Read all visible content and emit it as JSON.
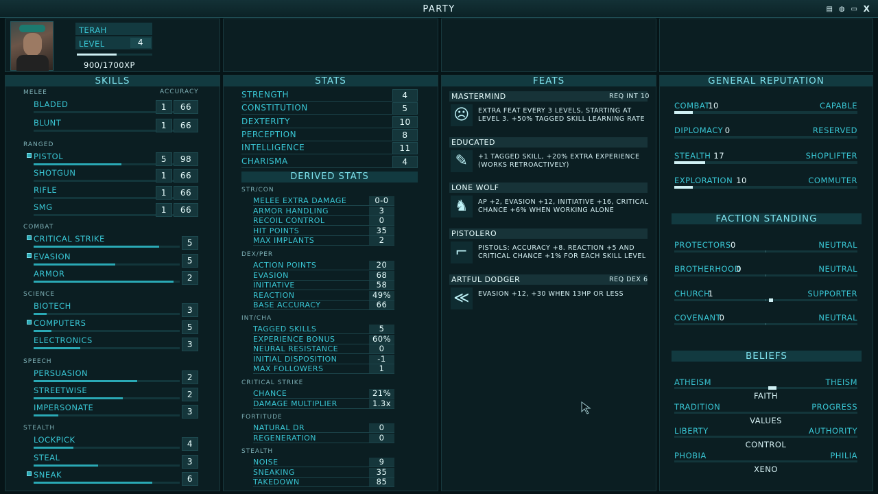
{
  "title": "PARTY",
  "icons": [
    "notepad-icon",
    "grenade-icon",
    "chat-icon",
    "close-icon"
  ],
  "close_label": "X",
  "character": {
    "name": "TERAH",
    "level_label": "LEVEL",
    "level": "4",
    "xp": "900/1700XP",
    "xp_progress": 0.53
  },
  "skills": {
    "header": "SKILLS",
    "accuracy_label": "ACCURACY",
    "groups": [
      {
        "name": "MELEE",
        "items": [
          {
            "label": "BLADED",
            "a": "1",
            "b": "66"
          },
          {
            "label": "BLUNT",
            "a": "1",
            "b": "66"
          }
        ]
      },
      {
        "name": "RANGED",
        "items": [
          {
            "label": "PISTOL",
            "a": "5",
            "b": "98",
            "tagged": true,
            "bar": 0.6
          },
          {
            "label": "SHOTGUN",
            "a": "1",
            "b": "66"
          },
          {
            "label": "RIFLE",
            "a": "1",
            "b": "66"
          },
          {
            "label": "SMG",
            "a": "1",
            "b": "66"
          }
        ]
      },
      {
        "name": "COMBAT",
        "items": [
          {
            "label": "CRITICAL STRIKE",
            "v": "5",
            "tagged": true,
            "bar": 0.86
          },
          {
            "label": "EVASION",
            "v": "5",
            "tagged": true,
            "bar": 0.56
          },
          {
            "label": "ARMOR",
            "v": "2",
            "bar": 0.96
          }
        ]
      },
      {
        "name": "SCIENCE",
        "items": [
          {
            "label": "BIOTECH",
            "v": "3",
            "bar": 0.09
          },
          {
            "label": "COMPUTERS",
            "v": "5",
            "tagged": true,
            "bar": 0.12
          },
          {
            "label": "ELECTRONICS",
            "v": "3",
            "bar": 0.32
          }
        ]
      },
      {
        "name": "SPEECH",
        "items": [
          {
            "label": "PERSUASION",
            "v": "2",
            "bar": 0.71
          },
          {
            "label": "STREETWISE",
            "v": "2",
            "bar": 0.61
          },
          {
            "label": "IMPERSONATE",
            "v": "3",
            "bar": 0.17
          }
        ]
      },
      {
        "name": "STEALTH",
        "items": [
          {
            "label": "LOCKPICK",
            "v": "4",
            "bar": 0.27
          },
          {
            "label": "STEAL",
            "v": "3",
            "bar": 0.44
          },
          {
            "label": "SNEAK",
            "v": "6",
            "tagged": true,
            "bar": 0.81
          }
        ]
      }
    ]
  },
  "stats": {
    "header": "STATS",
    "items": [
      {
        "label": "STRENGTH",
        "v": "4"
      },
      {
        "label": "CONSTITUTION",
        "v": "5"
      },
      {
        "label": "DEXTERITY",
        "v": "10"
      },
      {
        "label": "PERCEPTION",
        "v": "8"
      },
      {
        "label": "INTELLIGENCE",
        "v": "11"
      },
      {
        "label": "CHARISMA",
        "v": "4"
      }
    ]
  },
  "derived": {
    "header": "DERIVED STATS",
    "groups": [
      {
        "name": "STR/CON",
        "items": [
          {
            "label": "MELEE EXTRA DAMAGE",
            "v": "0-0"
          },
          {
            "label": "ARMOR HANDLING",
            "v": "3"
          },
          {
            "label": "RECOIL CONTROL",
            "v": "0"
          },
          {
            "label": "HIT POINTS",
            "v": "35"
          },
          {
            "label": "MAX IMPLANTS",
            "v": "2"
          }
        ]
      },
      {
        "name": "DEX/PER",
        "items": [
          {
            "label": "ACTION POINTS",
            "v": "20"
          },
          {
            "label": "EVASION",
            "v": "68"
          },
          {
            "label": "INITIATIVE",
            "v": "58"
          },
          {
            "label": "REACTION",
            "v": "49%"
          },
          {
            "label": "BASE ACCURACY",
            "v": "66"
          }
        ]
      },
      {
        "name": "INT/CHA",
        "items": [
          {
            "label": "TAGGED SKILLS",
            "v": "5"
          },
          {
            "label": "EXPERIENCE BONUS",
            "v": "60%"
          },
          {
            "label": "NEURAL RESISTANCE",
            "v": "0"
          },
          {
            "label": "INITIAL DISPOSITION",
            "v": "-1"
          },
          {
            "label": "MAX FOLLOWERS",
            "v": "1"
          }
        ]
      },
      {
        "name": "CRITICAL STRIKE",
        "items": [
          {
            "label": "CHANCE",
            "v": "21%"
          },
          {
            "label": "DAMAGE MULTIPLIER",
            "v": "1.3x"
          }
        ]
      },
      {
        "name": "FORTITUDE",
        "items": [
          {
            "label": "NATURAL DR",
            "v": "0"
          },
          {
            "label": "REGENERATION",
            "v": "0"
          }
        ]
      },
      {
        "name": "STEALTH",
        "items": [
          {
            "label": "NOISE",
            "v": "9"
          },
          {
            "label": "SNEAKING",
            "v": "35"
          },
          {
            "label": "TAKEDOWN",
            "v": "85"
          }
        ]
      }
    ]
  },
  "feats": {
    "header": "FEATS",
    "items": [
      {
        "name": "MASTERMIND",
        "req": "REQ INT 10",
        "icon": "head-gear-icon",
        "glyph": "☹",
        "l1": "EXTRA FEAT EVERY 3 LEVELS, STARTING AT",
        "l2": "LEVEL 3. +50% TAGGED SKILL LEARNING RATE"
      },
      {
        "name": "EDUCATED",
        "req": "",
        "icon": "book-icon",
        "glyph": "✎",
        "l1": "+1 TAGGED SKILL, +20% EXTRA EXPERIENCE",
        "l2": "(WORKS RETROACTIVELY)"
      },
      {
        "name": "LONE WOLF",
        "req": "",
        "icon": "wolf-icon",
        "glyph": "♞",
        "l1": "AP +2, EVASION +12, INITIATIVE +16, CRITICAL",
        "l2": "CHANCE +6% WHEN WORKING ALONE"
      },
      {
        "name": "PISTOLERO",
        "req": "",
        "icon": "pistol-icon",
        "glyph": "⌐",
        "l1": "PISTOLS: ACCURACY +8. REACTION +5 AND",
        "l2": "CRITICAL CHANCE +1% FOR EACH SKILL LEVEL"
      },
      {
        "name": "ARTFUL DODGER",
        "req": "REQ DEX 6",
        "icon": "dodge-icon",
        "glyph": "≪",
        "l1": "EVASION +12, +30 WHEN 13HP OR LESS",
        "l2": ""
      }
    ]
  },
  "reputation": {
    "header": "GENERAL REPUTATION",
    "items": [
      {
        "label": "COMBAT",
        "v": "10",
        "rank": "CAPABLE",
        "bar": 0.1
      },
      {
        "label": "DIPLOMACY",
        "v": "0",
        "rank": "RESERVED",
        "bar": 0
      },
      {
        "label": "STEALTH",
        "v": "17",
        "rank": "SHOPLIFTER",
        "bar": 0.17
      },
      {
        "label": "EXPLORATION",
        "v": "10",
        "rank": "COMMUTER",
        "bar": 0.1
      }
    ]
  },
  "factions": {
    "header": "FACTION STANDING",
    "items": [
      {
        "label": "PROTECTORS",
        "v": "0",
        "rank": "NEUTRAL",
        "pos": 0
      },
      {
        "label": "BROTHERHOOD",
        "v": "0",
        "rank": "NEUTRAL",
        "pos": 0
      },
      {
        "label": "CHURCH",
        "v": "1",
        "rank": "SUPPORTER",
        "pos": 0.02
      },
      {
        "label": "COVENANT",
        "v": "0",
        "rank": "NEUTRAL",
        "pos": 0
      }
    ]
  },
  "beliefs": {
    "header": "BELIEFS",
    "items": [
      {
        "left": "ATHEISM",
        "right": "THEISM",
        "name": "FAITH",
        "pos": 0.03
      },
      {
        "left": "TRADITION",
        "right": "PROGRESS",
        "name": "VALUES",
        "pos": 0
      },
      {
        "left": "LIBERTY",
        "right": "AUTHORITY",
        "name": "CONTROL",
        "pos": 0
      },
      {
        "left": "PHOBIA",
        "right": "PHILIA",
        "name": "XENO",
        "pos": 0
      }
    ]
  }
}
